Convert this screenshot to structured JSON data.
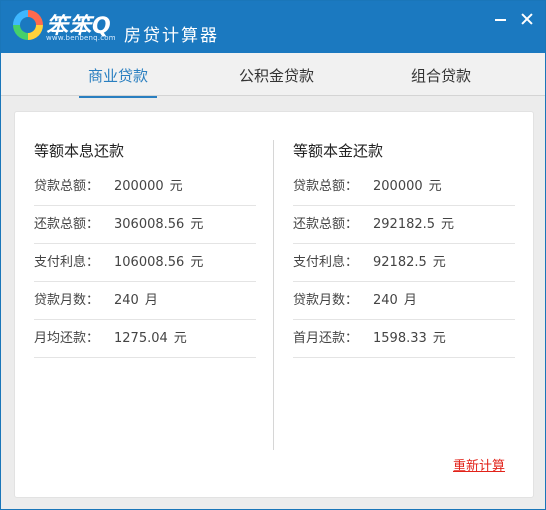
{
  "app": {
    "logo_text": "笨笨Q",
    "logo_url": "www.benbenq.com",
    "title": "房贷计算器"
  },
  "tabs": [
    {
      "label": "商业贷款",
      "active": true
    },
    {
      "label": "公积金贷款",
      "active": false
    },
    {
      "label": "组合贷款",
      "active": false
    }
  ],
  "equal_installment": {
    "title": "等额本息还款",
    "rows": [
      {
        "label": "贷款总额：",
        "value": "200000",
        "unit": "元"
      },
      {
        "label": "还款总额：",
        "value": "306008.56",
        "unit": "元"
      },
      {
        "label": "支付利息：",
        "value": "106008.56",
        "unit": "元"
      },
      {
        "label": "贷款月数：",
        "value": "240",
        "unit": "月"
      },
      {
        "label": "月均还款：",
        "value": "1275.04",
        "unit": "元"
      }
    ]
  },
  "equal_principal": {
    "title": "等额本金还款",
    "rows": [
      {
        "label": "贷款总额：",
        "value": "200000",
        "unit": "元"
      },
      {
        "label": "还款总额：",
        "value": "292182.5",
        "unit": "元"
      },
      {
        "label": "支付利息：",
        "value": "92182.5",
        "unit": "元"
      },
      {
        "label": "贷款月数：",
        "value": "240",
        "unit": "月"
      },
      {
        "label": "首月还款：",
        "value": "1598.33",
        "unit": "元"
      }
    ]
  },
  "actions": {
    "recalculate_label": "重新计算"
  },
  "colors": {
    "titlebar": "#1b79c0",
    "active_tab": "#2a7fc0",
    "link_red": "#e2231a"
  }
}
